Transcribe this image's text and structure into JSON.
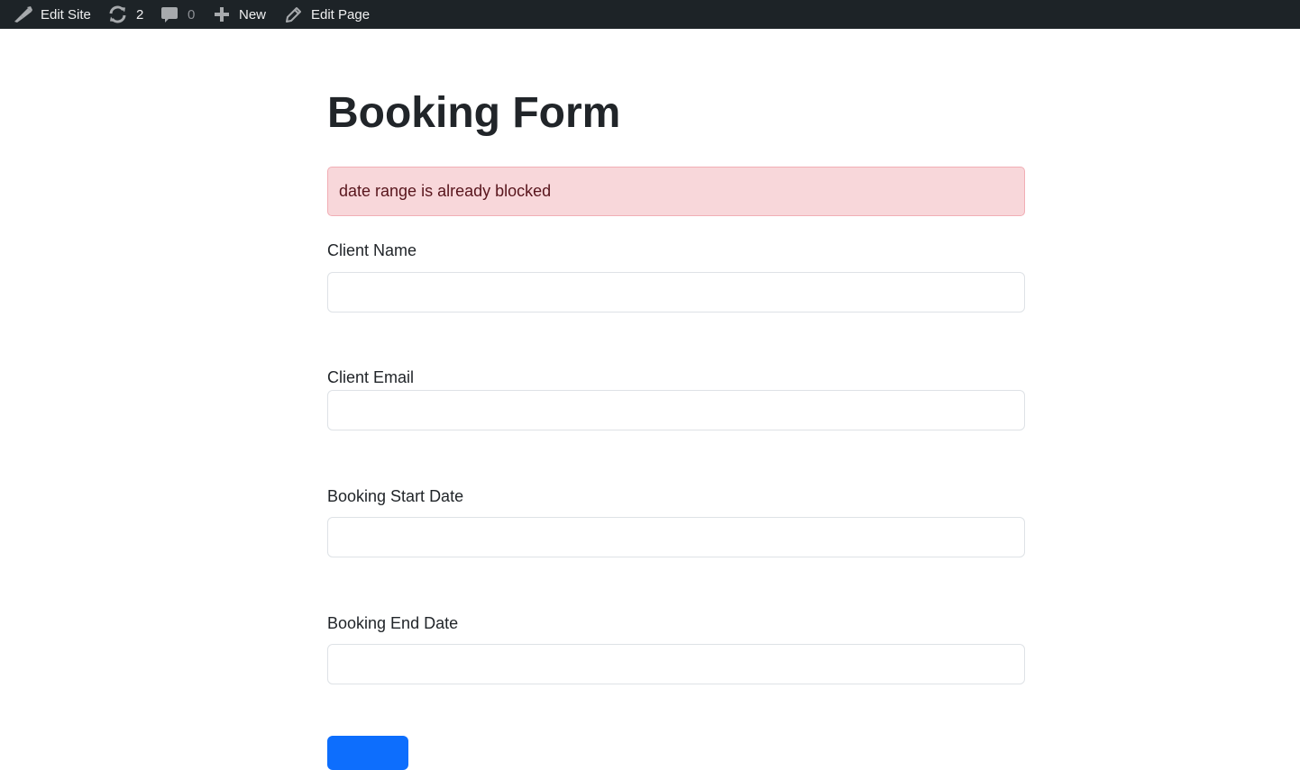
{
  "adminbar": {
    "edit_site_label": "Edit Site",
    "updates_count": "2",
    "comments_count": "0",
    "new_label": "New",
    "edit_page_label": "Edit Page",
    "background": "#1d2327"
  },
  "page": {
    "title": "Booking Form"
  },
  "alert": {
    "message": "date range is already blocked",
    "background": "#f8d7da",
    "text_color": "#58151c"
  },
  "form": {
    "client_name_label": "Client Name",
    "client_name_value": "",
    "client_email_label": "Client Email",
    "client_email_value": "",
    "start_date_label": "Booking Start Date",
    "start_date_value": "",
    "end_date_label": "Booking End Date",
    "end_date_value": "",
    "submit_label": ""
  },
  "icons": {
    "edit_site": "paintbrush-icon",
    "updates": "refresh-icon",
    "comments": "comment-bubble-icon",
    "new": "plus-icon",
    "edit_page": "pencil-icon"
  },
  "colors": {
    "primary_button": "#0d6efd"
  }
}
